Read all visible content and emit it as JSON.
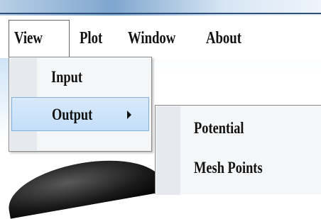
{
  "menubar": {
    "items": [
      {
        "label": "View"
      },
      {
        "label": "Plot"
      },
      {
        "label": "Window"
      },
      {
        "label": "About"
      }
    ]
  },
  "view_menu": {
    "items": [
      {
        "label": "Input",
        "has_submenu": false
      },
      {
        "label": "Output",
        "has_submenu": true,
        "highlighted": true
      }
    ]
  },
  "output_submenu": {
    "items": [
      {
        "label": "Potential"
      },
      {
        "label": "Mesh Points"
      }
    ]
  },
  "colors": {
    "highlight": "#c4defa",
    "highlight_border": "#7fb0e0",
    "menu_bg": "#f4f6f8"
  }
}
